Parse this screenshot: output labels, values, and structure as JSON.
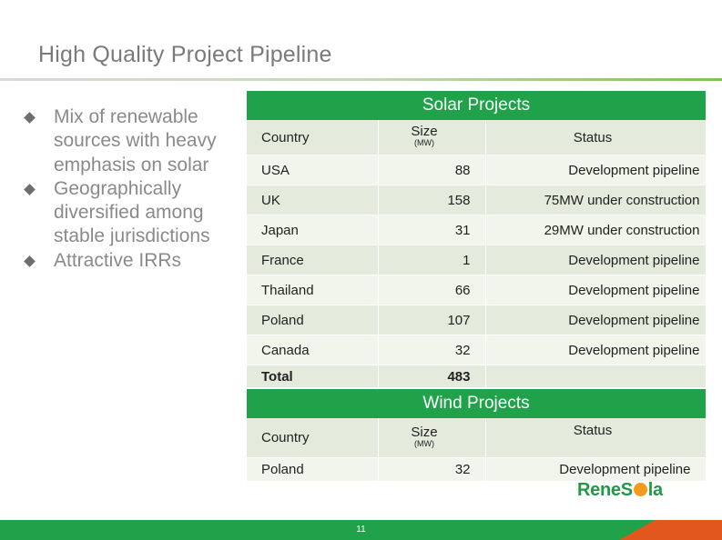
{
  "title": "High Quality Project Pipeline",
  "bullets": [
    "Mix of renewable sources with heavy emphasis on solar",
    "Geographically diversified among stable jurisdictions",
    "Attractive IRRs"
  ],
  "solar": {
    "heading": "Solar Projects",
    "col_country": "Country",
    "col_size": "Size",
    "col_size_unit": "(MW)",
    "col_status": "Status",
    "rows": [
      {
        "country": "USA",
        "size": "88",
        "status": "Development pipeline"
      },
      {
        "country": "UK",
        "size": "158",
        "status": "75MW under construction"
      },
      {
        "country": "Japan",
        "size": "31",
        "status": "29MW under construction"
      },
      {
        "country": "France",
        "size": "1",
        "status": "Development pipeline"
      },
      {
        "country": "Thailand",
        "size": "66",
        "status": "Development pipeline"
      },
      {
        "country": "Poland",
        "size": "107",
        "status": "Development pipeline"
      },
      {
        "country": "Canada",
        "size": "32",
        "status": "Development pipeline"
      }
    ],
    "total_label": "Total",
    "total_value": "483"
  },
  "wind": {
    "heading": "Wind Projects",
    "col_country": "Country",
    "col_size": "Size",
    "col_size_unit": "(MW)",
    "col_status": "Status",
    "rows": [
      {
        "country": "Poland",
        "size": "32",
        "status": "Development pipeline"
      }
    ]
  },
  "logo": {
    "part1": "Rene",
    "part2": "S",
    "part3": "la"
  },
  "page_number": "11",
  "colors": {
    "brand_green": "#1fa24a",
    "accent_orange": "#e2571d",
    "row_shade": "#e4ebdc"
  }
}
